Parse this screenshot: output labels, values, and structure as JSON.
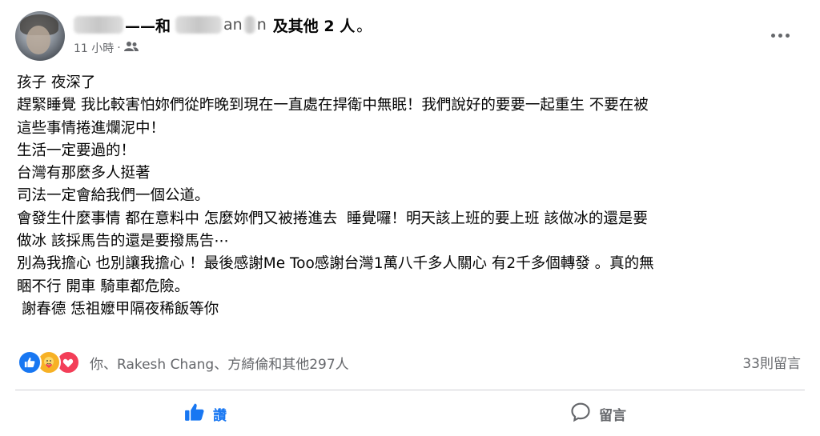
{
  "post": {
    "author": {
      "name_visible_fragment": "——和",
      "partner_name_visible_fragment": "an",
      "partner_name_fragment2": "n",
      "others": "及其他 2 人",
      "suffix": "。"
    },
    "timestamp": "11 小時",
    "separator": "·",
    "audience_icon": "friends-icon",
    "menu_icon": "more-horizontal-icon",
    "lines": [
      "孩子 夜深了",
      "趕緊睡覺 我比較害怕妳們從昨晚到現在一直處在捍衛中無眠！我們說好的要要一起重生 不要在被",
      "這些事情捲進爛泥中！",
      "生活一定要過的！",
      "台灣有那麼多人挺著",
      "司法一定會給我們一個公道。",
      "會發生什麼事情 都在意料中 怎麼妳們又被捲進去  睡覺囉！明天該上班的要上班 該做冰的還是要",
      "做冰 該採馬告的還是要撥馬告⋯",
      "別為我擔心 也別讓我擔心 ！最後感謝Me Too感謝台灣1萬八千多人關心 有2千多個轉發 。真的無",
      "睏不行 開車 騎車都危險。",
      " 謝春德 恁祖嬤甲隔夜稀飯等你"
    ],
    "reactions": {
      "types": [
        "like",
        "care",
        "love"
      ],
      "summary": "你、Rakesh Chang、方綺倫和其他297人",
      "colors": {
        "like": "#1877f2",
        "care": "#f7b125",
        "love": "#f33e58"
      }
    },
    "comments_count": "33則留言",
    "actions": {
      "like_label": "讚",
      "comment_label": "留言"
    }
  }
}
